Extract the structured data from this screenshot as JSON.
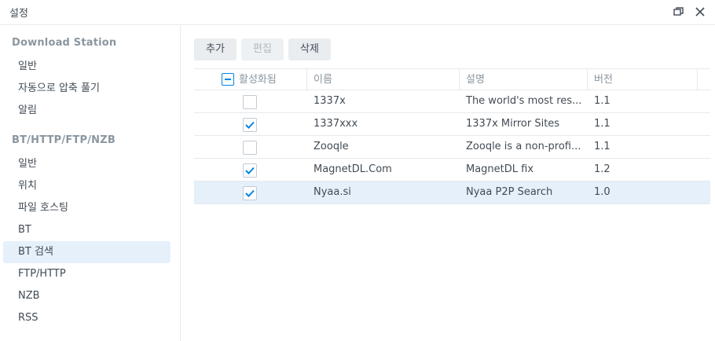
{
  "window": {
    "title": "설정"
  },
  "sidebar": {
    "groups": [
      {
        "title": "Download Station",
        "items": [
          {
            "label": "일반"
          },
          {
            "label": "자동으로 압축 풀기"
          },
          {
            "label": "알림"
          }
        ]
      },
      {
        "title": "BT/HTTP/FTP/NZB",
        "items": [
          {
            "label": "일반"
          },
          {
            "label": "위치"
          },
          {
            "label": "파일 호스팅"
          },
          {
            "label": "BT"
          },
          {
            "label": "BT 검색",
            "active": true
          },
          {
            "label": "FTP/HTTP"
          },
          {
            "label": "NZB"
          },
          {
            "label": "RSS"
          }
        ]
      }
    ]
  },
  "toolbar": {
    "add_label": "추가",
    "edit_label": "편집",
    "delete_label": "삭제"
  },
  "table": {
    "headers": {
      "enabled": "활성화됨",
      "name": "이름",
      "description": "설명",
      "version": "버전"
    },
    "rows": [
      {
        "enabled": false,
        "name": "1337x",
        "description": "The world's most res...",
        "version": "1.1"
      },
      {
        "enabled": true,
        "name": "1337xxx",
        "description": "1337x Mirror Sites",
        "version": "1.1"
      },
      {
        "enabled": false,
        "name": "Zooqle",
        "description": "Zooqle is a non-profi...",
        "version": "1.1"
      },
      {
        "enabled": true,
        "name": "MagnetDL.Com",
        "description": "MagnetDL fix",
        "version": "1.2"
      },
      {
        "enabled": true,
        "name": "Nyaa.si",
        "description": "Nyaa P2P Search",
        "version": "1.0",
        "selected": true
      }
    ]
  },
  "colors": {
    "accent": "#0086e5",
    "selection": "#e5f0fb",
    "muted_text": "#8a96a0"
  }
}
